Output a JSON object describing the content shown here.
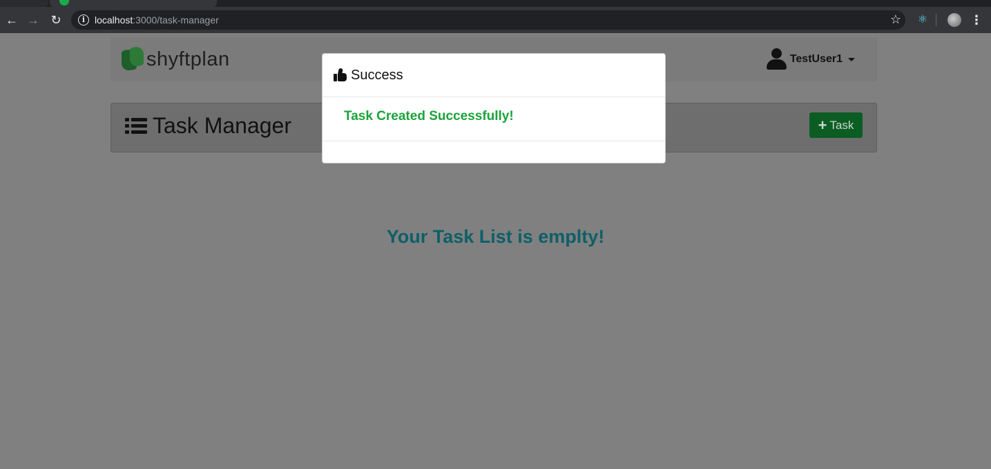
{
  "browser": {
    "url_host": "localhost",
    "url_path": ":3000/task-manager"
  },
  "app": {
    "logo_text": "shyftplan",
    "username": "TestUser1"
  },
  "header": {
    "title": "Task Manager",
    "add_task_label": "Task"
  },
  "main": {
    "empty_message": "Your Task List is emplty!"
  },
  "modal": {
    "title": "Success",
    "message": "Task Created Successfully!"
  },
  "colors": {
    "brand_green": "#0b5d23",
    "success_text": "#1aa33a",
    "empty_text": "#0e5f67",
    "backdrop": "#808080"
  }
}
